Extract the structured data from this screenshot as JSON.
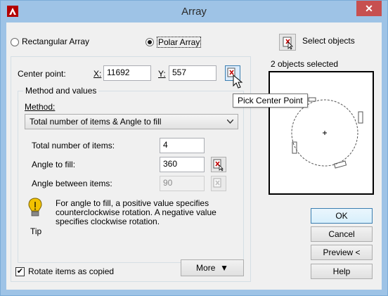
{
  "window": {
    "title": "Array",
    "close_glyph": "✕"
  },
  "array_type": {
    "rectangular_label": "Rectangular Array",
    "polar_label": "Polar Array",
    "selected": "polar"
  },
  "selection": {
    "select_button_label": "Select objects",
    "status": "2 objects selected"
  },
  "center_point": {
    "label": "Center point:",
    "x_label": "X:",
    "x_value": "11692",
    "y_label": "Y:",
    "y_value": "557"
  },
  "method_group": {
    "title": "Method and values",
    "method_label": "Method:",
    "method_value": "Total number of items & Angle to fill",
    "total_items_label": "Total number of items:",
    "total_items_value": "4",
    "angle_fill_label": "Angle to fill:",
    "angle_fill_value": "360",
    "angle_between_label": "Angle between items:",
    "angle_between_value": "90"
  },
  "tip": {
    "text_line1": "For angle to fill, a positive value specifies",
    "text_line2": "counterclockwise rotation.  A negative value",
    "text_line3": "specifies clockwise rotation.",
    "label": "Tip"
  },
  "rotate": {
    "label": "Rotate items as copied",
    "checked": true,
    "check_glyph": "✔"
  },
  "more_button": {
    "label": "More",
    "glyph": "▼"
  },
  "tooltip": {
    "text": "Pick Center Point"
  },
  "buttons": {
    "ok": "OK",
    "cancel": "Cancel",
    "preview": "Preview <",
    "help": "Help"
  },
  "colors": {
    "title_bar": "#9ec3e6",
    "close_button": "#c75050",
    "dialog_bg": "#f0f0f0",
    "tip_icon": "#f2c200"
  }
}
